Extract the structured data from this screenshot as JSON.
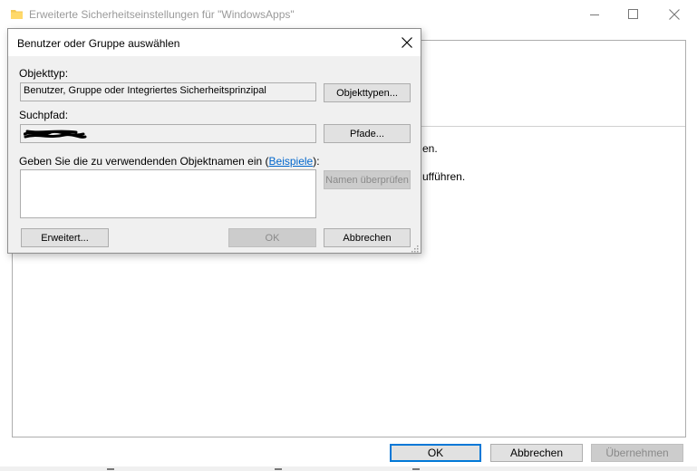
{
  "background_window": {
    "title": "Erweiterte Sicherheitseinstellungen für \"WindowsApps\"",
    "icon": "folder-icon",
    "partial_text_1": "en.",
    "partial_text_2": "ufführen.",
    "buttons": {
      "ok": "OK",
      "cancel": "Abbrechen",
      "apply": "Übernehmen"
    }
  },
  "dialog": {
    "title": "Benutzer oder Gruppe auswählen",
    "object_type": {
      "label": "Objekttyp:",
      "value": "Benutzer, Gruppe oder Integriertes Sicherheitsprinzipal",
      "button": "Objekttypen..."
    },
    "search_path": {
      "label": "Suchpfad:",
      "value": "",
      "button": "Pfade..."
    },
    "object_names": {
      "label_prefix": "Geben Sie die zu verwendenden Objektnamen ein (",
      "label_link": "Beispiele",
      "label_suffix": "):",
      "value": "",
      "check_button": "Namen überprüfen"
    },
    "buttons": {
      "advanced": "Erweitert...",
      "ok": "OK",
      "cancel": "Abbrechen"
    }
  },
  "colors": {
    "dialog_bg": "#f0f0f0",
    "button_bg": "#e1e1e1",
    "button_border": "#adadad",
    "accent_focus": "#0078d7",
    "link": "#0066cc",
    "disabled_text": "#8a8a8a"
  }
}
